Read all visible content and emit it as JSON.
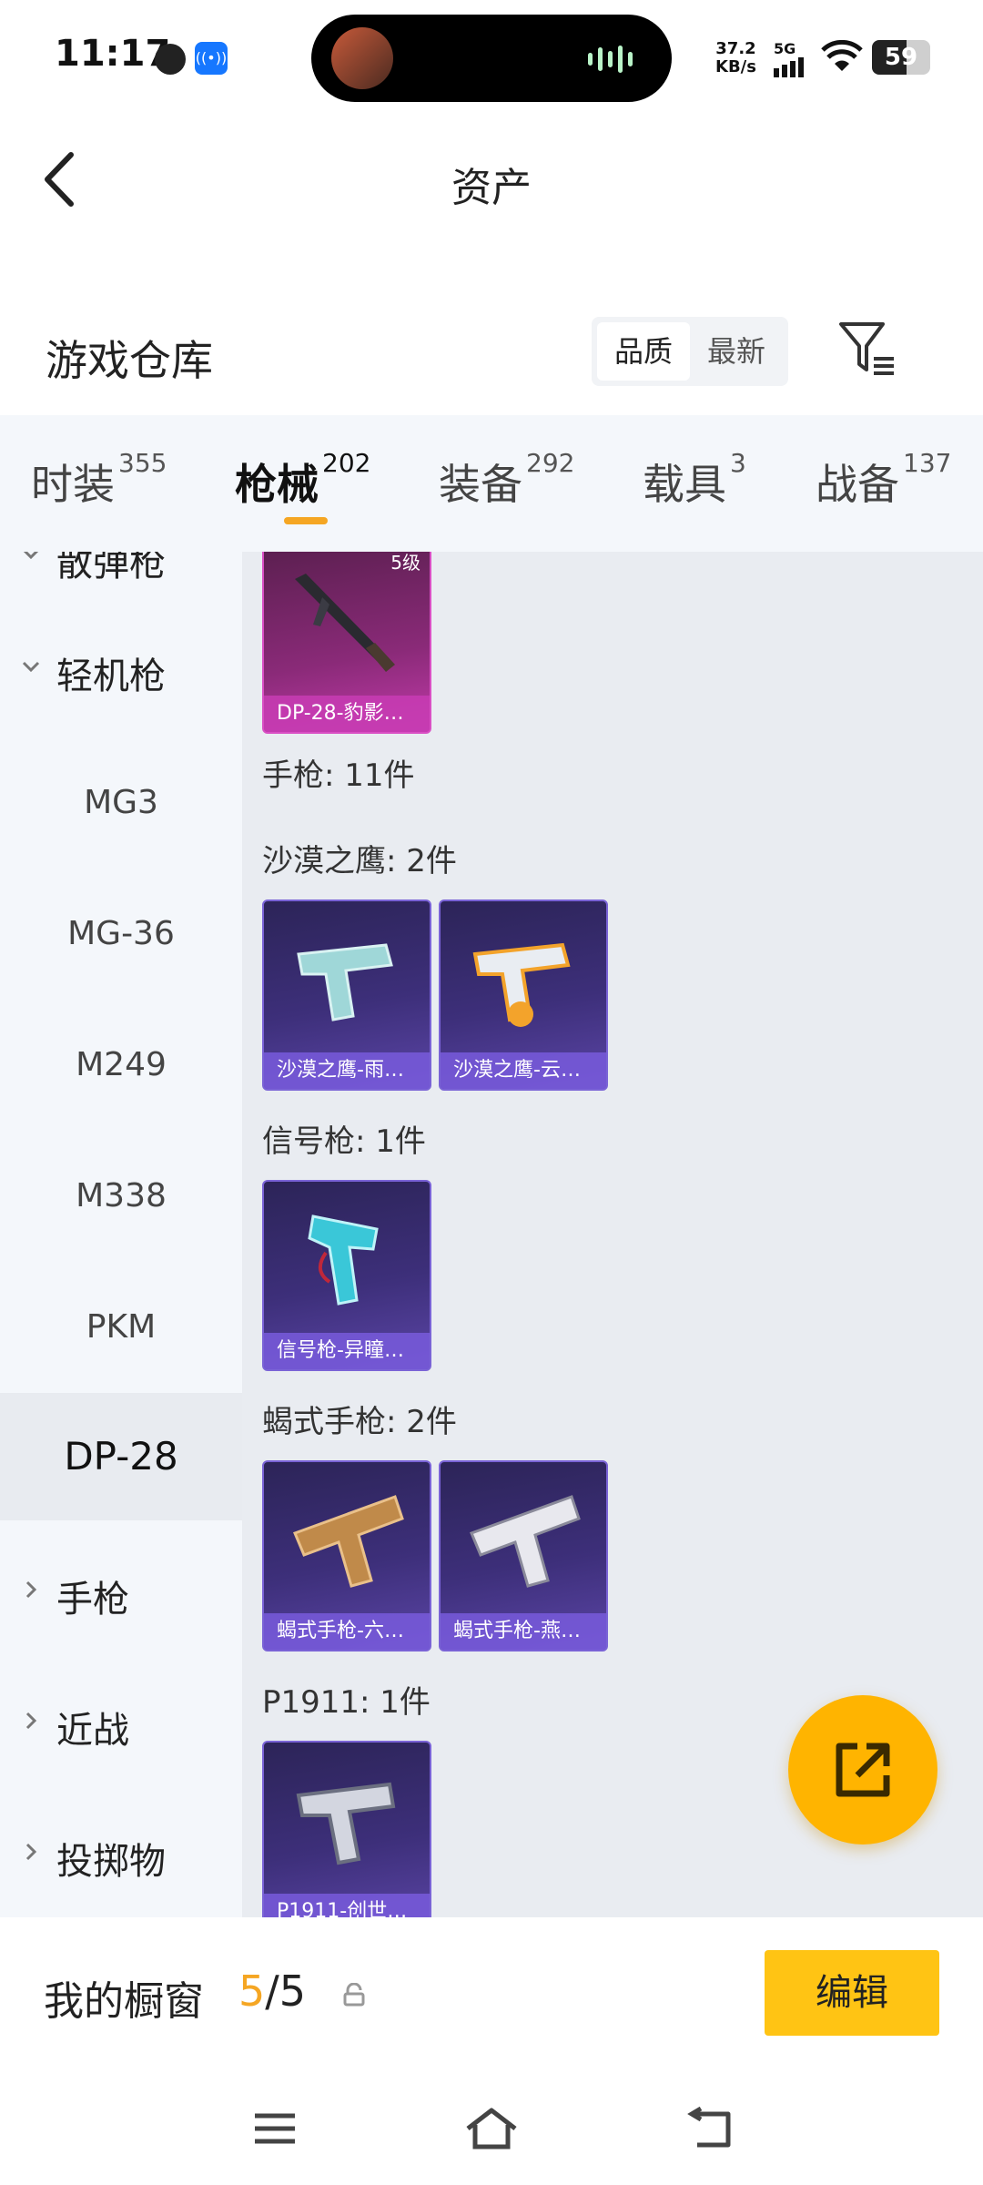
{
  "status": {
    "time": "11:17",
    "net_speed_value": "37.2",
    "net_speed_unit": "KB/s",
    "signal_label": "5G",
    "battery": "59",
    "battery_level": 0.59
  },
  "header": {
    "title": "资产"
  },
  "section": {
    "title": "游戏仓库",
    "sort_options": [
      "品质",
      "最新"
    ],
    "sort_selected": "品质"
  },
  "tabs": [
    {
      "label": "时装",
      "count": "355"
    },
    {
      "label": "枪械",
      "count": "202",
      "active": true
    },
    {
      "label": "装备",
      "count": "292"
    },
    {
      "label": "载具",
      "count": "3"
    },
    {
      "label": "战备",
      "count": "137"
    }
  ],
  "sidebar": {
    "group_prev": "散弹枪",
    "group_open": "轻机枪",
    "items": [
      "MG3",
      "MG-36",
      "M249",
      "M338",
      "PKM",
      "DP-28"
    ],
    "selected": "DP-28",
    "groups_after": [
      "手枪",
      "近战",
      "投掷物"
    ]
  },
  "content": {
    "top_card": {
      "name": "DP-28-豹影…",
      "level": "5级"
    },
    "pistol_heading": "手枪: 11件",
    "groups": [
      {
        "label": "沙漠之鹰: 2件",
        "cards": [
          "沙漠之鹰-雨…",
          "沙漠之鹰-云…"
        ]
      },
      {
        "label": "信号枪: 1件",
        "cards": [
          "信号枪-异瞳…"
        ]
      },
      {
        "label": "蝎式手枪: 2件",
        "cards": [
          "蝎式手枪-六…",
          "蝎式手枪-燕…"
        ]
      },
      {
        "label": "P1911: 1件",
        "cards": [
          "P1911-创世…"
        ]
      }
    ]
  },
  "showcase": {
    "label": "我的橱窗",
    "current": "5",
    "separator": "/",
    "total": "5",
    "edit_label": "编辑"
  },
  "colors": {
    "accent": "#f5a623",
    "button": "#ffc414",
    "fab": "#ffb400"
  }
}
